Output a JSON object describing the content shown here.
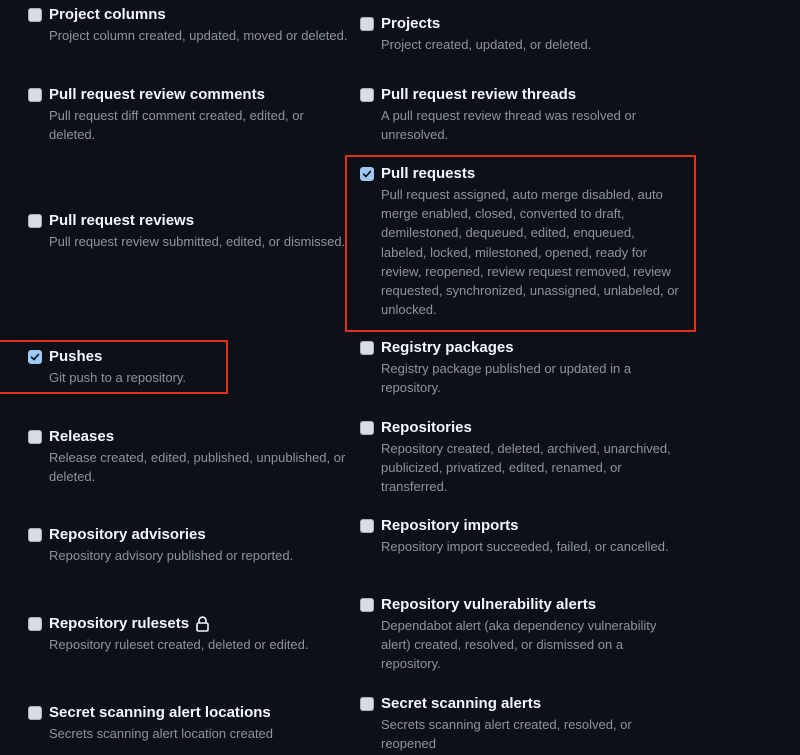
{
  "events": [
    {
      "id": "project-columns",
      "label": "Project columns",
      "description": "Project column created, updated, moved or deleted.",
      "checked": false
    },
    {
      "id": "projects",
      "label": "Projects",
      "description": "Project created, updated, or deleted.",
      "checked": false
    },
    {
      "id": "pull-request-review-comments",
      "label": "Pull request review comments",
      "description": "Pull request diff comment created, edited, or deleted.",
      "checked": false
    },
    {
      "id": "pull-request-review-threads",
      "label": "Pull request review threads",
      "description": "A pull request review thread was resolved or unresolved.",
      "checked": false
    },
    {
      "id": "pull-requests",
      "label": "Pull requests",
      "description": "Pull request assigned, auto merge disabled, auto merge enabled, closed, converted to draft, demilestoned, dequeued, edited, enqueued, labeled, locked, milestoned, opened, ready for review, reopened, review request removed, review requested, synchronized, unassigned, unlabeled, or unlocked.",
      "checked": true
    },
    {
      "id": "pull-request-reviews",
      "label": "Pull request reviews",
      "description": "Pull request review submitted, edited, or dismissed.",
      "checked": false
    },
    {
      "id": "pushes",
      "label": "Pushes",
      "description": "Git push to a repository.",
      "checked": true
    },
    {
      "id": "registry-packages",
      "label": "Registry packages",
      "description": "Registry package published or updated in a repository.",
      "checked": false
    },
    {
      "id": "releases",
      "label": "Releases",
      "description": "Release created, edited, published, unpublished, or deleted.",
      "checked": false
    },
    {
      "id": "repositories",
      "label": "Repositories",
      "description": "Repository created, deleted, archived, unarchived, publicized, privatized, edited, renamed, or transferred.",
      "checked": false
    },
    {
      "id": "repository-advisories",
      "label": "Repository advisories",
      "description": "Repository advisory published or reported.",
      "checked": false
    },
    {
      "id": "repository-imports",
      "label": "Repository imports",
      "description": "Repository import succeeded, failed, or cancelled.",
      "checked": false
    },
    {
      "id": "repository-rulesets",
      "label": "Repository rulesets",
      "description": "Repository ruleset created, deleted or edited.",
      "checked": false,
      "icon": "lock-icon"
    },
    {
      "id": "repository-vulnerability-alerts",
      "label": "Repository vulnerability alerts",
      "description": "Dependabot alert (aka dependency vulnerability alert) created, resolved, or dismissed on a repository.",
      "checked": false
    },
    {
      "id": "secret-scanning-alert-locations",
      "label": "Secret scanning alert locations",
      "description": "Secrets scanning alert location created",
      "checked": false
    },
    {
      "id": "secret-scanning-alerts",
      "label": "Secret scanning alerts",
      "description": "Secrets scanning alert created, resolved, or reopened",
      "checked": false
    }
  ],
  "colors": {
    "background": "#0d1117",
    "title": "#f0f6fc",
    "description": "#8b949e",
    "checkbox_checked": "#9ec9f5",
    "highlight": "#e0321f"
  }
}
